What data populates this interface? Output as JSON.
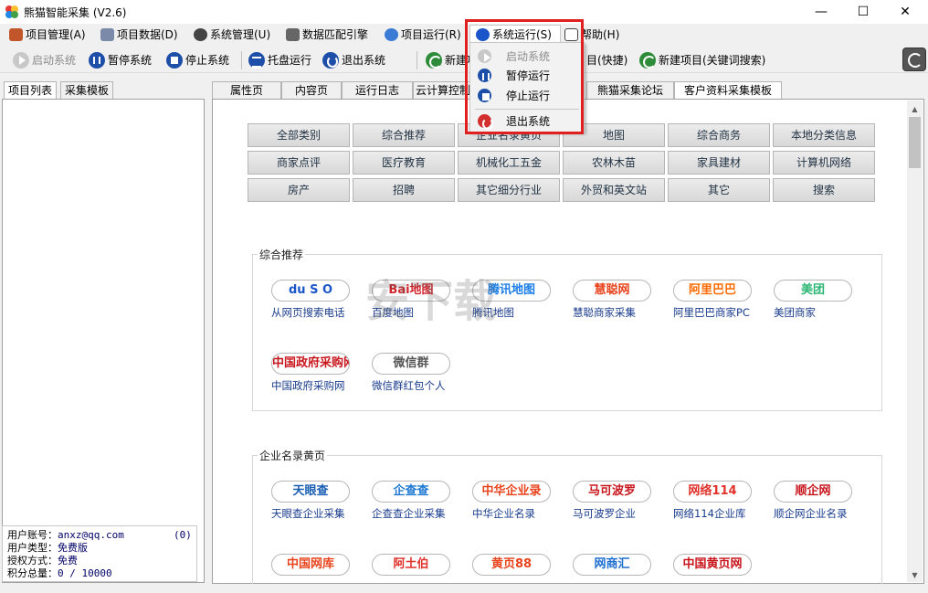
{
  "window": {
    "title": "熊猫智能采集  (V2.6)",
    "min": "—",
    "max": "☐",
    "close": "✕"
  },
  "menu": [
    {
      "label": "项目管理(A)"
    },
    {
      "label": "项目数据(D)"
    },
    {
      "label": "系统管理(U)"
    },
    {
      "label": "数据匹配引擎"
    },
    {
      "label": "项目运行(R)"
    },
    {
      "label": "系统运行(S)"
    },
    {
      "label": "帮助(H)"
    }
  ],
  "toolbar": {
    "start": "启动系统",
    "pause": "暂停系统",
    "stop": "停止系统",
    "tray": "托盘运行",
    "exit": "退出系统",
    "new_project": "新建项",
    "new_project_fast": "目(快捷)",
    "new_project_keyword": "新建项目(关键词搜索)"
  },
  "dropdown": {
    "start": "启动系统",
    "pause": "暂停运行",
    "stop": "停止运行",
    "exit": "退出系统"
  },
  "left_tabs": [
    "项目列表",
    "采集模板"
  ],
  "user": {
    "account_label": "用户账号：",
    "account": "anxz@qq.com",
    "account_count": "(0)",
    "type_label": "用户类型：",
    "type": "免费版",
    "auth_label": "授权方式：",
    "auth": "免费",
    "points_label": "积分总量：",
    "points": "0 / 10000"
  },
  "right_tabs": [
    "属性页",
    "内容页",
    "运行日志",
    "云计算控制",
    "熊猫采集论坛",
    "客户资料采集模板"
  ],
  "categories": [
    [
      "全部类别",
      "综合推荐",
      "企业名录黄页",
      "地图",
      "综合商务",
      "本地分类信息"
    ],
    [
      "商家点评",
      "医疗教育",
      "机械化工五金",
      "农林木苗",
      "家具建材",
      "计算机网络"
    ],
    [
      "房产",
      "招聘",
      "其它细分行业",
      "外贸和英文站",
      "其它",
      "搜索"
    ]
  ],
  "sections": [
    {
      "title": "综合推荐",
      "sites": [
        {
          "logo": "du S O",
          "name": "从网页搜索电话",
          "color": "#1a56c9"
        },
        {
          "logo": "Bai地图",
          "name": "百度地图",
          "color": "#d0262d"
        },
        {
          "logo": "腾讯地图",
          "name": "腾讯地图",
          "color": "#1a7de6"
        },
        {
          "logo": "慧聪网",
          "name": "慧聪商家采集",
          "color": "#e8431c"
        },
        {
          "logo": "阿里巴巴",
          "name": "阿里巴巴商家PC",
          "color": "#ff6a00"
        },
        {
          "logo": "美团",
          "name": "美团商家",
          "color": "#2bb673"
        },
        {
          "logo": "中国政府采购网",
          "name": "中国政府采购网",
          "color": "#c8161d"
        },
        {
          "logo": "微信群",
          "name": "微信群红包个人",
          "color": "#555555"
        }
      ]
    },
    {
      "title": "企业名录黄页",
      "sites": [
        {
          "logo": "天眼查",
          "name": "天眼查企业采集",
          "color": "#1a5fb4"
        },
        {
          "logo": "企查查",
          "name": "企查查企业采集",
          "color": "#1f78d1"
        },
        {
          "logo": "中华企业录",
          "name": "中华企业名录",
          "color": "#e8431c"
        },
        {
          "logo": "马可波罗",
          "name": "马可波罗企业",
          "color": "#c8161d"
        },
        {
          "logo": "网络114",
          "name": "网络114企业库",
          "color": "#e0312a"
        },
        {
          "logo": "顺企网",
          "name": "顺企网企业名录",
          "color": "#c8161d"
        },
        {
          "logo": "中国网库",
          "name": "",
          "color": "#e8431c"
        },
        {
          "logo": "阿土伯",
          "name": "",
          "color": "#e0312a"
        },
        {
          "logo": "黄页88",
          "name": "",
          "color": "#e8431c"
        },
        {
          "logo": "网商汇",
          "name": "",
          "color": "#1f6fd1"
        },
        {
          "logo": "中国黄页网",
          "name": "",
          "color": "#c8161d"
        }
      ]
    }
  ]
}
